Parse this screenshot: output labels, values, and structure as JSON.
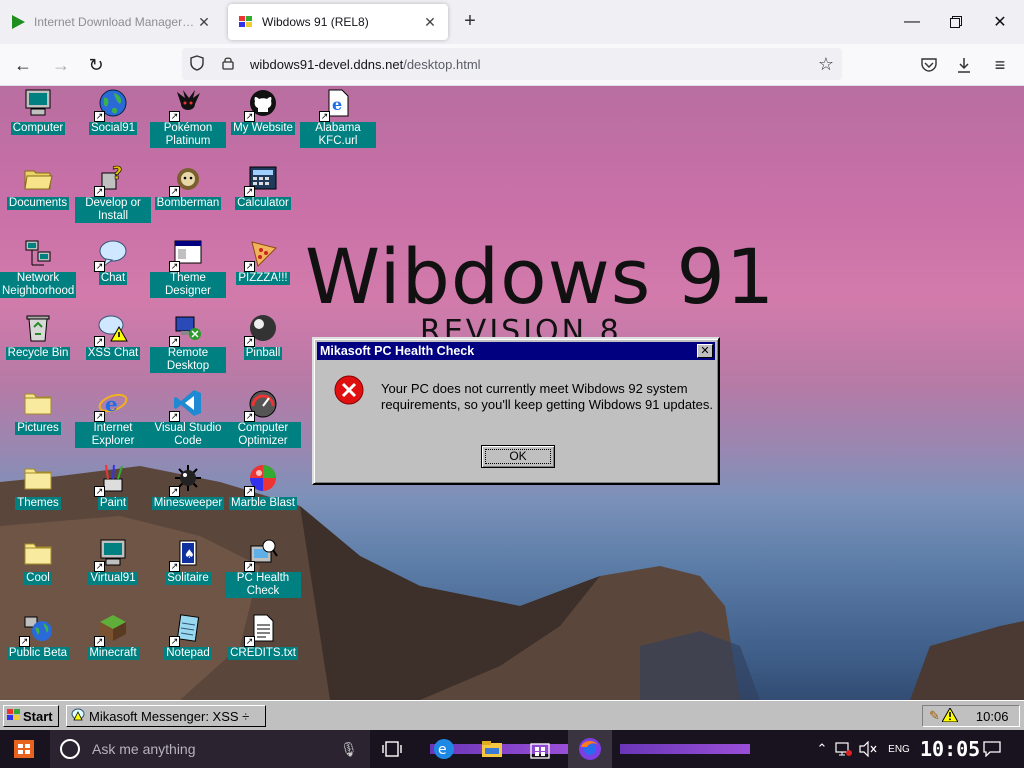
{
  "browser": {
    "tabs": [
      {
        "title": "Internet Download Manager: The f",
        "active": false
      },
      {
        "title": "Wibdows 91 (REL8)",
        "active": true
      }
    ],
    "url_host": "wibdows91-devel.ddns.net",
    "url_path": "/desktop.html"
  },
  "desktop": {
    "watermark_title": "Wibdows 91",
    "watermark_subtitle": "REVISION 8",
    "icons": [
      {
        "label": "Computer",
        "icon": "computer-icon"
      },
      {
        "label": "Social91",
        "icon": "globe-icon"
      },
      {
        "label": "Pokémon Platinum",
        "icon": "pokemon-icon"
      },
      {
        "label": "My Website",
        "icon": "github-icon"
      },
      {
        "label": "Alabama KFC.url",
        "icon": "ie-document-icon"
      },
      {
        "label": "Documents",
        "icon": "folder-open-icon"
      },
      {
        "label": "Develop or Install",
        "icon": "help-setup-icon"
      },
      {
        "label": "Bomberman",
        "icon": "bomberman-icon"
      },
      {
        "label": "Calculator",
        "icon": "calculator-icon"
      },
      {
        "label": "Network Neighborhood",
        "icon": "network-icon"
      },
      {
        "label": "Chat",
        "icon": "chat-bubble-icon"
      },
      {
        "label": "Theme Designer",
        "icon": "window-icon"
      },
      {
        "label": "PIZZZA!!!",
        "icon": "pizza-icon"
      },
      {
        "label": "Recycle Bin",
        "icon": "recycle-bin-icon"
      },
      {
        "label": "XSS Chat",
        "icon": "chat-warning-icon"
      },
      {
        "label": "Remote Desktop",
        "icon": "remote-desktop-icon"
      },
      {
        "label": "Pinball",
        "icon": "pinball-icon"
      },
      {
        "label": "Pictures",
        "icon": "folder-icon"
      },
      {
        "label": "Internet Explorer",
        "icon": "ie-icon"
      },
      {
        "label": "Visual Studio Code",
        "icon": "vscode-icon"
      },
      {
        "label": "Computer Optimizer",
        "icon": "gauge-icon"
      },
      {
        "label": "Themes",
        "icon": "folder-icon"
      },
      {
        "label": "Paint",
        "icon": "paint-icon"
      },
      {
        "label": "Minesweeper",
        "icon": "mine-icon"
      },
      {
        "label": "Marble Blast",
        "icon": "marble-icon"
      },
      {
        "label": "Cool",
        "icon": "folder-icon"
      },
      {
        "label": "Virtual91",
        "icon": "computer-icon"
      },
      {
        "label": "Solitaire",
        "icon": "cards-icon"
      },
      {
        "label": "PC Health Check",
        "icon": "health-check-icon"
      },
      {
        "label": "Public Beta",
        "icon": "network-globe-icon"
      },
      {
        "label": "Minecraft",
        "icon": "minecraft-icon"
      },
      {
        "label": "Notepad",
        "icon": "notepad-icon"
      },
      {
        "label": "CREDITS.txt",
        "icon": "text-file-icon"
      }
    ]
  },
  "dialog": {
    "title": "Mikasoft PC Health Check",
    "message": "Your PC does not currently meet Wibdows 92 system requirements, so you'll keep getting Wibdows 91 updates.",
    "ok_label": "OK",
    "icon": "error-icon"
  },
  "w91_taskbar": {
    "start_label": "Start",
    "task_label": "Mikasoft Messenger: XSS ÷",
    "clock": "10:06"
  },
  "host_taskbar": {
    "search_placeholder": "Ask me anything",
    "lang": "ENG",
    "clock": "10:05"
  }
}
